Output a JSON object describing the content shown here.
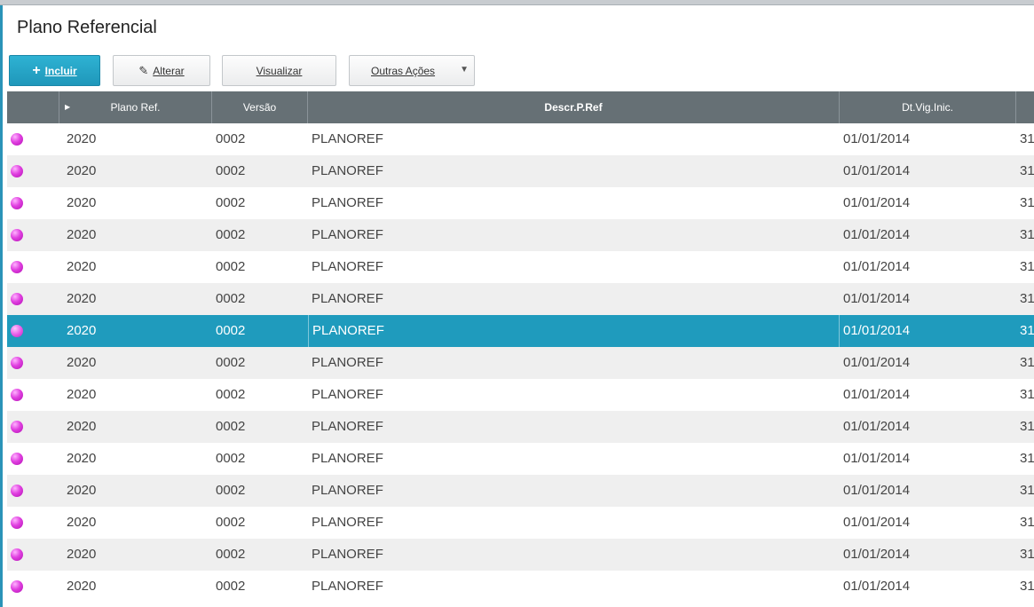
{
  "page": {
    "title": "Plano Referencial"
  },
  "toolbar": {
    "incluir": {
      "icon": "+",
      "label": "Incluir"
    },
    "alterar": {
      "icon": "✎",
      "label": "Alterar"
    },
    "visualizar": {
      "label": "Visualizar"
    },
    "outras": {
      "label": "Outras Ações",
      "caret": "▼"
    }
  },
  "grid": {
    "columns": {
      "plano": "Plano Ref.",
      "versao": "Versão",
      "descr": "Descr.P.Ref",
      "dtvig": "Dt.Vig.Inic."
    },
    "selected_index": 6,
    "status_color": "#d633d6",
    "rows": [
      {
        "plano": "2020",
        "versao": "0002",
        "descr": "PLANOREF",
        "dtvig": "01/01/2014",
        "extra": "31"
      },
      {
        "plano": "2020",
        "versao": "0002",
        "descr": "PLANOREF",
        "dtvig": "01/01/2014",
        "extra": "31"
      },
      {
        "plano": "2020",
        "versao": "0002",
        "descr": "PLANOREF",
        "dtvig": "01/01/2014",
        "extra": "31"
      },
      {
        "plano": "2020",
        "versao": "0002",
        "descr": "PLANOREF",
        "dtvig": "01/01/2014",
        "extra": "31"
      },
      {
        "plano": "2020",
        "versao": "0002",
        "descr": "PLANOREF",
        "dtvig": "01/01/2014",
        "extra": "31"
      },
      {
        "plano": "2020",
        "versao": "0002",
        "descr": "PLANOREF",
        "dtvig": "01/01/2014",
        "extra": "31"
      },
      {
        "plano": "2020",
        "versao": "0002",
        "descr": "PLANOREF",
        "dtvig": "01/01/2014",
        "extra": "31"
      },
      {
        "plano": "2020",
        "versao": "0002",
        "descr": "PLANOREF",
        "dtvig": "01/01/2014",
        "extra": "31"
      },
      {
        "plano": "2020",
        "versao": "0002",
        "descr": "PLANOREF",
        "dtvig": "01/01/2014",
        "extra": "31"
      },
      {
        "plano": "2020",
        "versao": "0002",
        "descr": "PLANOREF",
        "dtvig": "01/01/2014",
        "extra": "31"
      },
      {
        "plano": "2020",
        "versao": "0002",
        "descr": "PLANOREF",
        "dtvig": "01/01/2014",
        "extra": "31"
      },
      {
        "plano": "2020",
        "versao": "0002",
        "descr": "PLANOREF",
        "dtvig": "01/01/2014",
        "extra": "31"
      },
      {
        "plano": "2020",
        "versao": "0002",
        "descr": "PLANOREF",
        "dtvig": "01/01/2014",
        "extra": "31"
      },
      {
        "plano": "2020",
        "versao": "0002",
        "descr": "PLANOREF",
        "dtvig": "01/01/2014",
        "extra": "31"
      },
      {
        "plano": "2020",
        "versao": "0002",
        "descr": "PLANOREF",
        "dtvig": "01/01/2014",
        "extra": "31"
      }
    ]
  }
}
